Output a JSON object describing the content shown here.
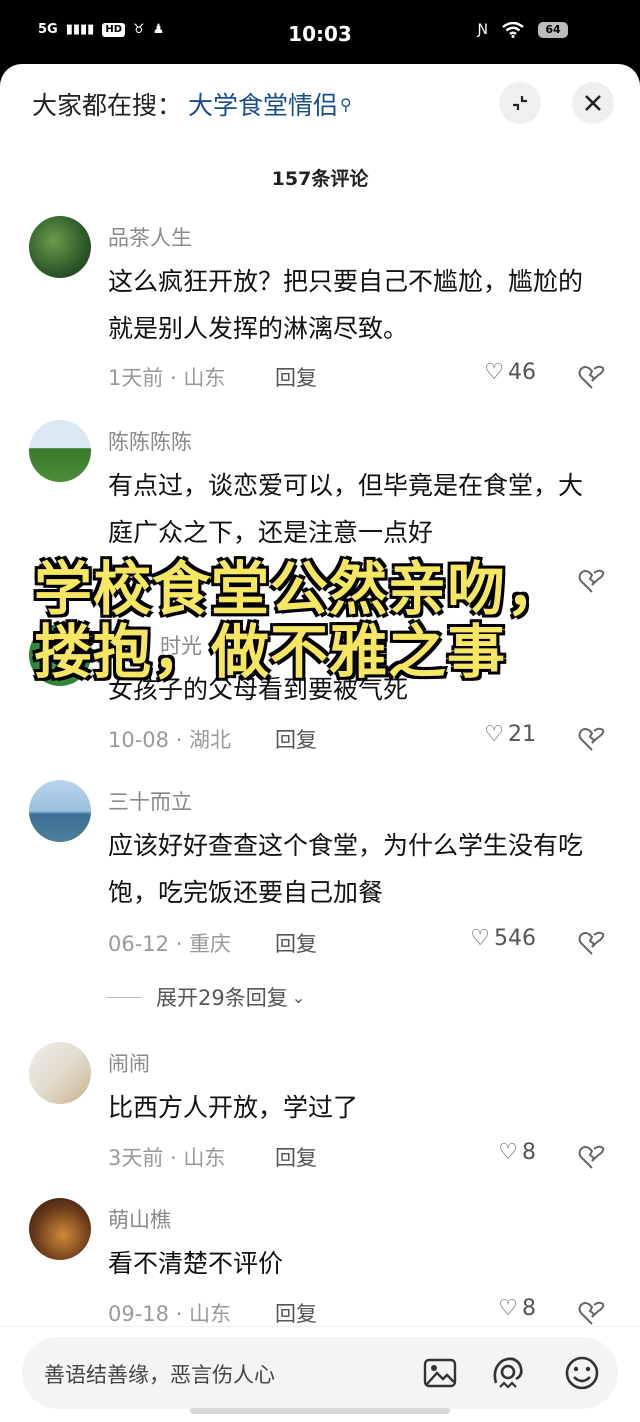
{
  "status": {
    "network": "5G",
    "hd": "HD",
    "time": "10:03",
    "battery": "64"
  },
  "header": {
    "search_prefix": "大家都在搜：",
    "search_term": "大学食堂情侣",
    "collapse_icon": "collapse-icon",
    "close_icon": "close-icon"
  },
  "comment_count": "157条评论",
  "comments": [
    {
      "name": "品茶人生",
      "text": "这么疯狂开放？把只要自己不尴尬，尴尬的就是别人发挥的淋漓尽致。",
      "meta": "1天前 · 山东",
      "reply": "回复",
      "likes": "46"
    },
    {
      "name": "陈陈陈陈",
      "text": "有点过，谈恋爱可以，但毕竟是在食堂，大庭广众之下，还是注意一点好",
      "meta": "",
      "reply": "回复",
      "likes": ""
    },
    {
      "name": "时光",
      "text": "女孩子的父母看到要被气死",
      "meta": "10-08 · 湖北",
      "reply": "回复",
      "likes": "21"
    },
    {
      "name": "三十而立",
      "text": "应该好好查查这个食堂，为什么学生没有吃饱，吃完饭还要自己加餐",
      "meta": "06-12 · 重庆",
      "reply": "回复",
      "likes": "546"
    },
    {
      "name": "闹闹",
      "text": "比西方人开放，学过了",
      "meta": "3天前 · 山东",
      "reply": "回复",
      "likes": "8"
    },
    {
      "name": "萌山樵",
      "text": "看不清楚不评价",
      "meta": "09-18 · 山东",
      "reply": "回复",
      "likes": "8"
    }
  ],
  "expand_replies": "展开29条回复",
  "overlay_caption": {
    "line1": "学校食堂公然亲吻，",
    "line2": "搂抱，做不雅之事"
  },
  "input": {
    "placeholder": "善语结善缘，恶言伤人心",
    "icons": [
      "image-icon",
      "at-mention-icon",
      "emoji-icon"
    ]
  }
}
